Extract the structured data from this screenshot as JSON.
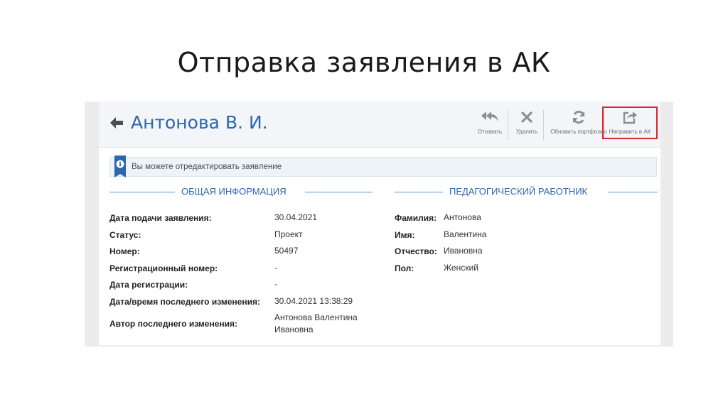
{
  "slide_title": "Отправка заявления в АК",
  "header": {
    "person_name": "Антонова В. И.",
    "actions": [
      {
        "label": "Отозвать",
        "icon": "reply-all-icon"
      },
      {
        "label": "Удалить",
        "icon": "close-icon"
      },
      {
        "label": "Обновить портфолио",
        "icon": "refresh-icon"
      },
      {
        "label": "Направить в АК",
        "icon": "share-icon"
      }
    ]
  },
  "notice": {
    "text": "Вы можете отредактировать заявление",
    "icon": "info-icon"
  },
  "general": {
    "title": "ОБЩАЯ ИНФОРМАЦИЯ",
    "rows": [
      {
        "label": "Дата подачи заявления:",
        "value": "30.04.2021"
      },
      {
        "label": "Статус:",
        "value": "Проект"
      },
      {
        "label": "Номер:",
        "value": "50497"
      },
      {
        "label": "Регистрационный номер:",
        "value": "-"
      },
      {
        "label": "Дата регистрации:",
        "value": "-"
      },
      {
        "label": "Дата/время последнего изменения:",
        "value": "30.04.2021 13:38:29"
      },
      {
        "label": "Автор последнего изменения:",
        "value_line1": "Антонова Валентина",
        "value_line2": "Ивановна"
      }
    ]
  },
  "teacher": {
    "title": "ПЕДАГОГИЧЕСКИЙ РАБОТНИК",
    "rows": [
      {
        "label": "Фамилия:",
        "value": "Антонова"
      },
      {
        "label": "Имя:",
        "value": "Валентина"
      },
      {
        "label": "Отчество:",
        "value": "Ивановна"
      },
      {
        "label": "Пол:",
        "value": "Женский"
      }
    ]
  },
  "colors": {
    "accent": "#2b67b0",
    "highlight": "#d9262b"
  }
}
